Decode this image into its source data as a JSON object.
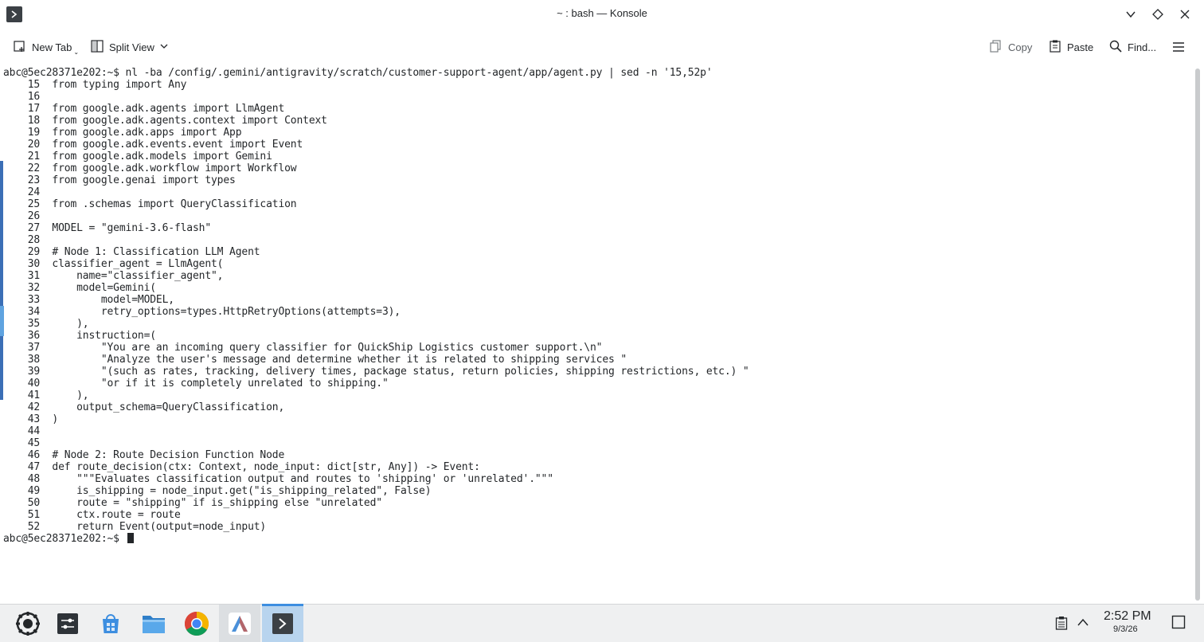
{
  "window": {
    "title": "~ : bash — Konsole"
  },
  "toolbar": {
    "new_tab": "New Tab",
    "split_view": "Split View",
    "copy": "Copy",
    "paste": "Paste",
    "find": "Find..."
  },
  "terminal": {
    "lines": [
      "abc@5ec28371e202:~$ nl -ba /config/.gemini/antigravity/scratch/customer-support-agent/app/agent.py | sed -n '15,52p'",
      "    15  from typing import Any",
      "    16",
      "    17  from google.adk.agents import LlmAgent",
      "    18  from google.adk.agents.context import Context",
      "    19  from google.adk.apps import App",
      "    20  from google.adk.events.event import Event",
      "    21  from google.adk.models import Gemini",
      "    22  from google.adk.workflow import Workflow",
      "    23  from google.genai import types",
      "    24",
      "    25  from .schemas import QueryClassification",
      "    26",
      "    27  MODEL = \"gemini-3.6-flash\"",
      "    28",
      "    29  # Node 1: Classification LLM Agent",
      "    30  classifier_agent = LlmAgent(",
      "    31      name=\"classifier_agent\",",
      "    32      model=Gemini(",
      "    33          model=MODEL,",
      "    34          retry_options=types.HttpRetryOptions(attempts=3),",
      "    35      ),",
      "    36      instruction=(",
      "    37          \"You are an incoming query classifier for QuickShip Logistics customer support.\\n\"",
      "    38          \"Analyze the user's message and determine whether it is related to shipping services \"",
      "    39          \"(such as rates, tracking, delivery times, package status, return policies, shipping restrictions, etc.) \"",
      "    40          \"or if it is completely unrelated to shipping.\"",
      "    41      ),",
      "    42      output_schema=QueryClassification,",
      "    43  )",
      "    44",
      "    45",
      "    46  # Node 2: Route Decision Function Node",
      "    47  def route_decision(ctx: Context, node_input: dict[str, Any]) -> Event:",
      "    48      \"\"\"Evaluates classification output and routes to 'shipping' or 'unrelated'.\"\"\"",
      "    49      is_shipping = node_input.get(\"is_shipping_related\", False)",
      "    50      route = \"shipping\" if is_shipping else \"unrelated\"",
      "    51      ctx.route = route",
      "    52      return Event(output=node_input)",
      "abc@5ec28371e202:~$ "
    ]
  },
  "taskbar": {
    "apps": [
      "application-launcher-icon",
      "system-settings-icon",
      "discover-store-icon",
      "file-manager-icon",
      "chrome-icon",
      "antigravity-icon",
      "konsole-icon"
    ],
    "clock_time": "2:52 PM",
    "clock_date": "9/3/26"
  }
}
